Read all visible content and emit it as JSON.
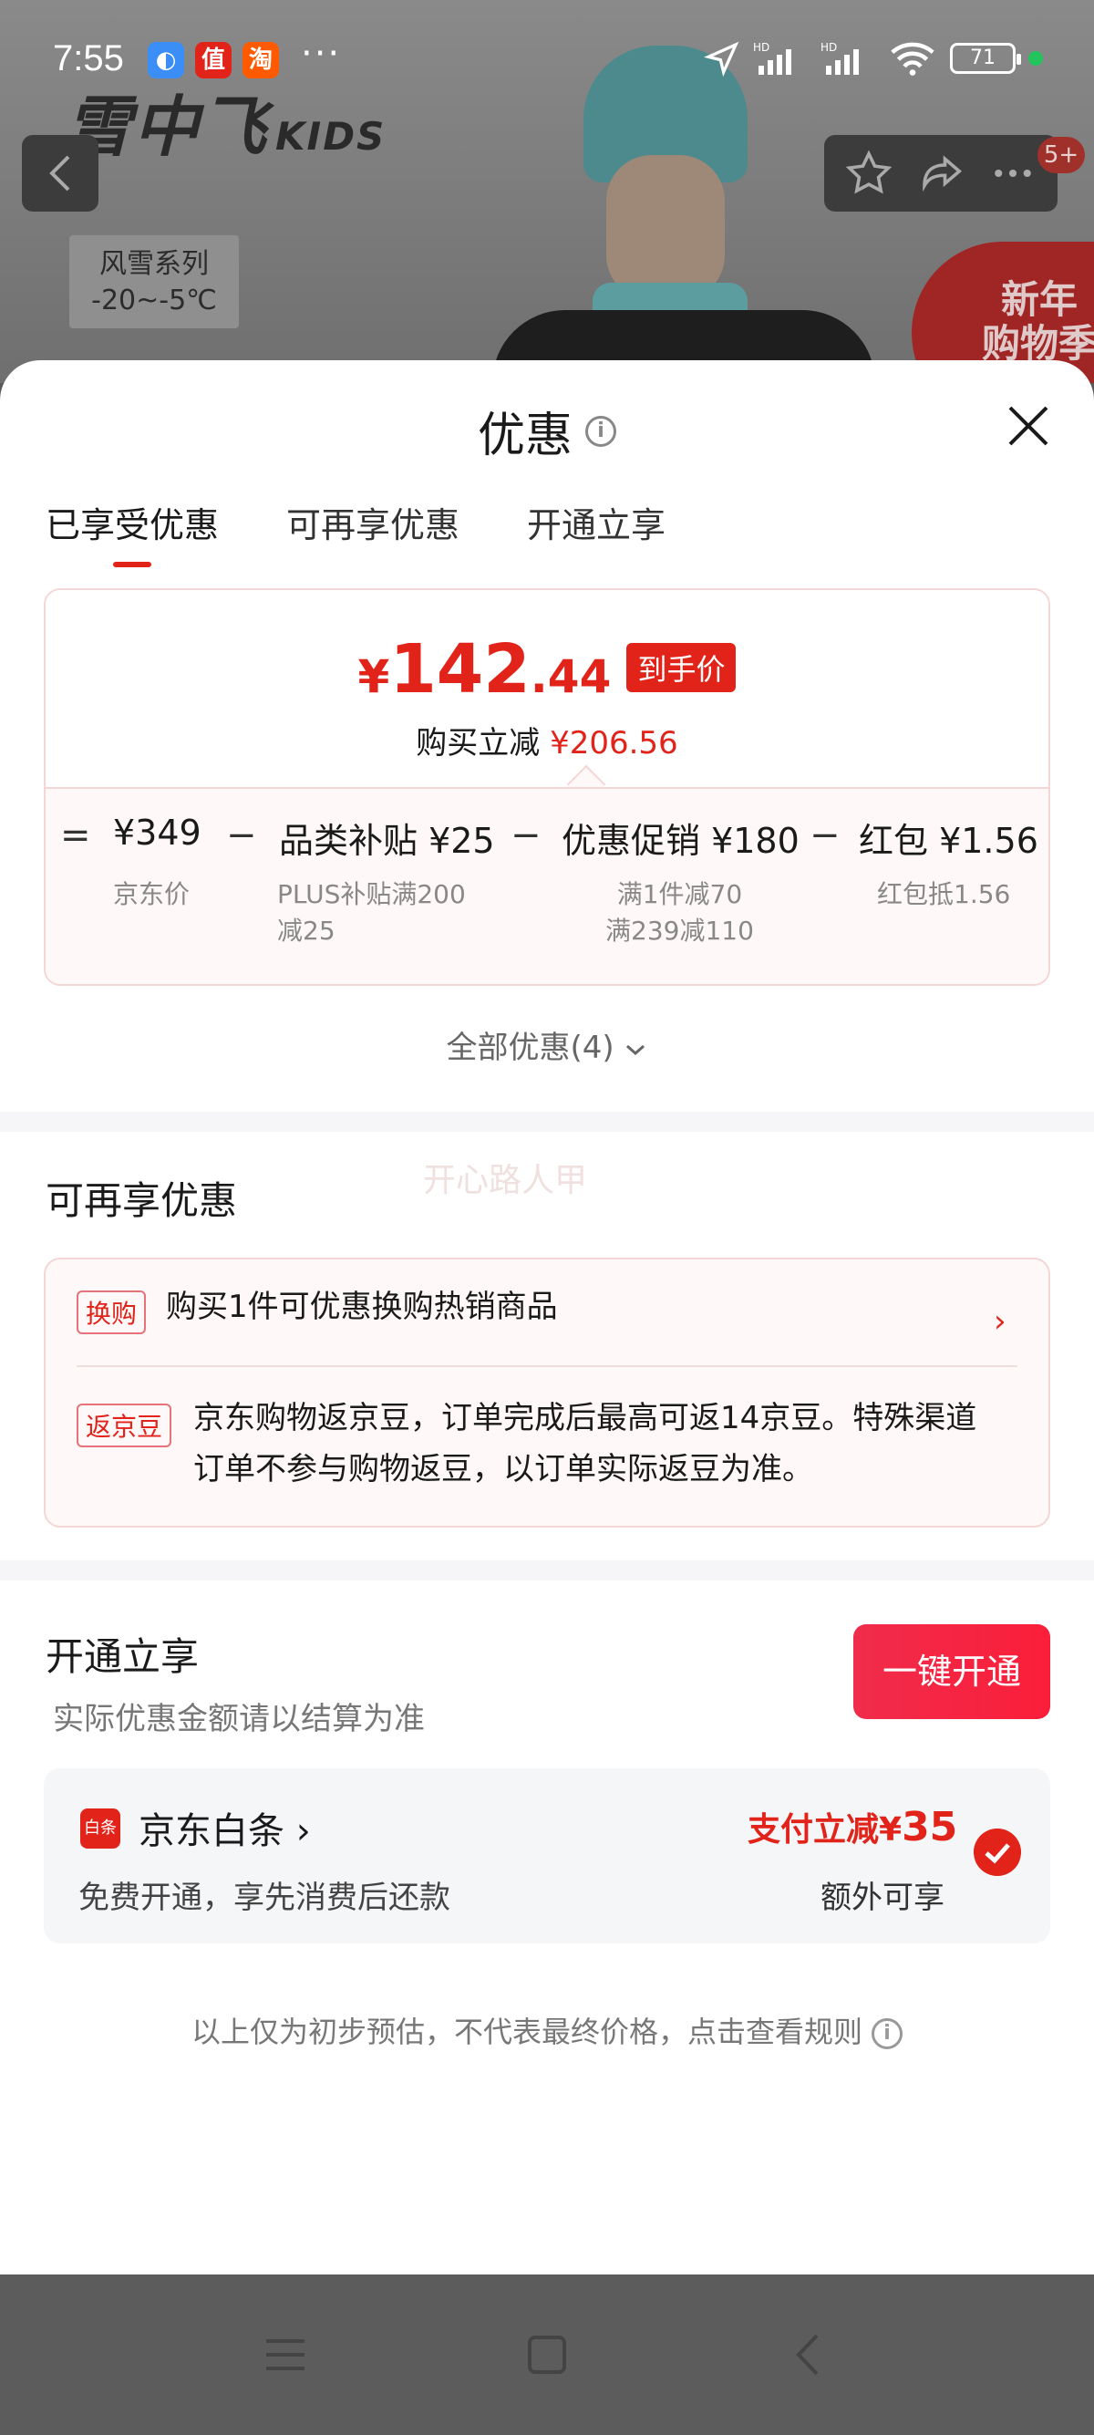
{
  "status_bar": {
    "time": "7:55",
    "app_icons": [
      {
        "name": "browser-app-icon",
        "glyph": "◐",
        "color": "#3a8ef6"
      },
      {
        "name": "zhi-app-icon",
        "glyph": "值",
        "color": "#e2231a"
      },
      {
        "name": "taobao-app-icon",
        "glyph": "淘",
        "color": "#ff5a00"
      }
    ],
    "more": "···",
    "battery": "71",
    "network": "HD"
  },
  "background_page": {
    "brand": "雪中飞",
    "brand_sub": "KIDS",
    "series_line1": "风雪系列",
    "series_line2": "-20~-5℃",
    "promo_line1": "新年",
    "promo_line2": "购物季",
    "badge": "5+"
  },
  "sheet": {
    "title": "优惠",
    "tabs": [
      "已享受优惠",
      "可再享优惠",
      "开通立享"
    ],
    "active_tab": 0
  },
  "price": {
    "currency": "¥",
    "integer": "142",
    "decimal": ".44",
    "tag": "到手价",
    "reduce_label": "购买立减",
    "reduce_amount": "¥206.56"
  },
  "calc": {
    "equals": "=",
    "minus": "−",
    "items": [
      {
        "label": "¥349",
        "sub": "京东价"
      },
      {
        "label": "品类补贴 ¥25",
        "sub1": "PLUS补贴满200",
        "sub2": "减25"
      },
      {
        "label": "优惠促销 ¥180",
        "sub1": "满1件减70",
        "sub2": "满239减110"
      },
      {
        "label": "红包 ¥1.56",
        "sub": "红包抵1.56"
      }
    ]
  },
  "all_discounts": "全部优惠(4)",
  "extra_section": {
    "title": "可再享优惠",
    "watermark": "开心路人甲",
    "row1_tag": "换购",
    "row1_text": "购买1件可优惠换购热销商品",
    "row2_tag": "返京豆",
    "row2_line1": "京东购物返京豆，订单完成后最高可返14京豆。特殊渠道",
    "row2_line2": "订单不参与购物返豆，以订单实际返豆为准。"
  },
  "open_section": {
    "title": "开通立享",
    "subtitle": "实际优惠金额请以结算为准",
    "button": "一键开通",
    "baitiao_logo": "白条",
    "baitiao_name": "京东白条",
    "baitiao_desc": "免费开通，享先消费后还款",
    "promo_prefix": "支付立减¥",
    "promo_amount": "35",
    "extra": "额外可享"
  },
  "disclaimer": "以上仅为初步预估，不代表最终价格，点击查看规则",
  "colors": {
    "accent": "#e2231a",
    "card_border": "#f5d6d6"
  }
}
